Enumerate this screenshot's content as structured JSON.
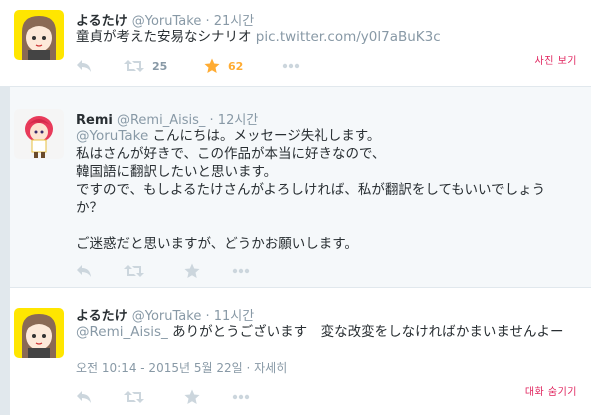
{
  "tweets": [
    {
      "name": "よるたけ",
      "handle": "@YoruTake",
      "sep": "·",
      "time": "21시간",
      "text": "童貞が考えた安易なシナリオ",
      "link": "pic.twitter.com/y0l7aBuK3c",
      "retweet_count": "25",
      "favorite_count": "62",
      "side_link": "사진 보기"
    },
    {
      "name": "Remi",
      "handle": "@Remi_Aisis_",
      "sep": "·",
      "time": "12시간",
      "mention": "@YoruTake",
      "lines": [
        "こんにちは。メッセージ失礼します。",
        "私はさんが好きで、この作品が本当に好きなので、",
        "韓国語に翻訳したいと思います。",
        "ですので、もしよるたけさんがよろしければ、私が翻訳をしてもいいでしょう",
        "か？",
        "",
        "ご迷惑だと思いますが、どうかお願いします。"
      ]
    },
    {
      "name": "よるたけ",
      "handle": "@YoruTake",
      "sep": "·",
      "time": "11시간",
      "mention": "@Remi_Aisis_",
      "text": "ありがとうございます　変な改変をしなければかまいませんよー",
      "meta_date": "오전 10:14 - 2015년 5월 22일",
      "meta_sep": "·",
      "meta_detail": "자세히",
      "side_link": "대화 숨기기"
    }
  ],
  "colors": {
    "favorite_active": "#ffac33",
    "action_grey": "#ccd6dd",
    "secondary_text": "#8899a6",
    "red_link": "#e0245e"
  }
}
